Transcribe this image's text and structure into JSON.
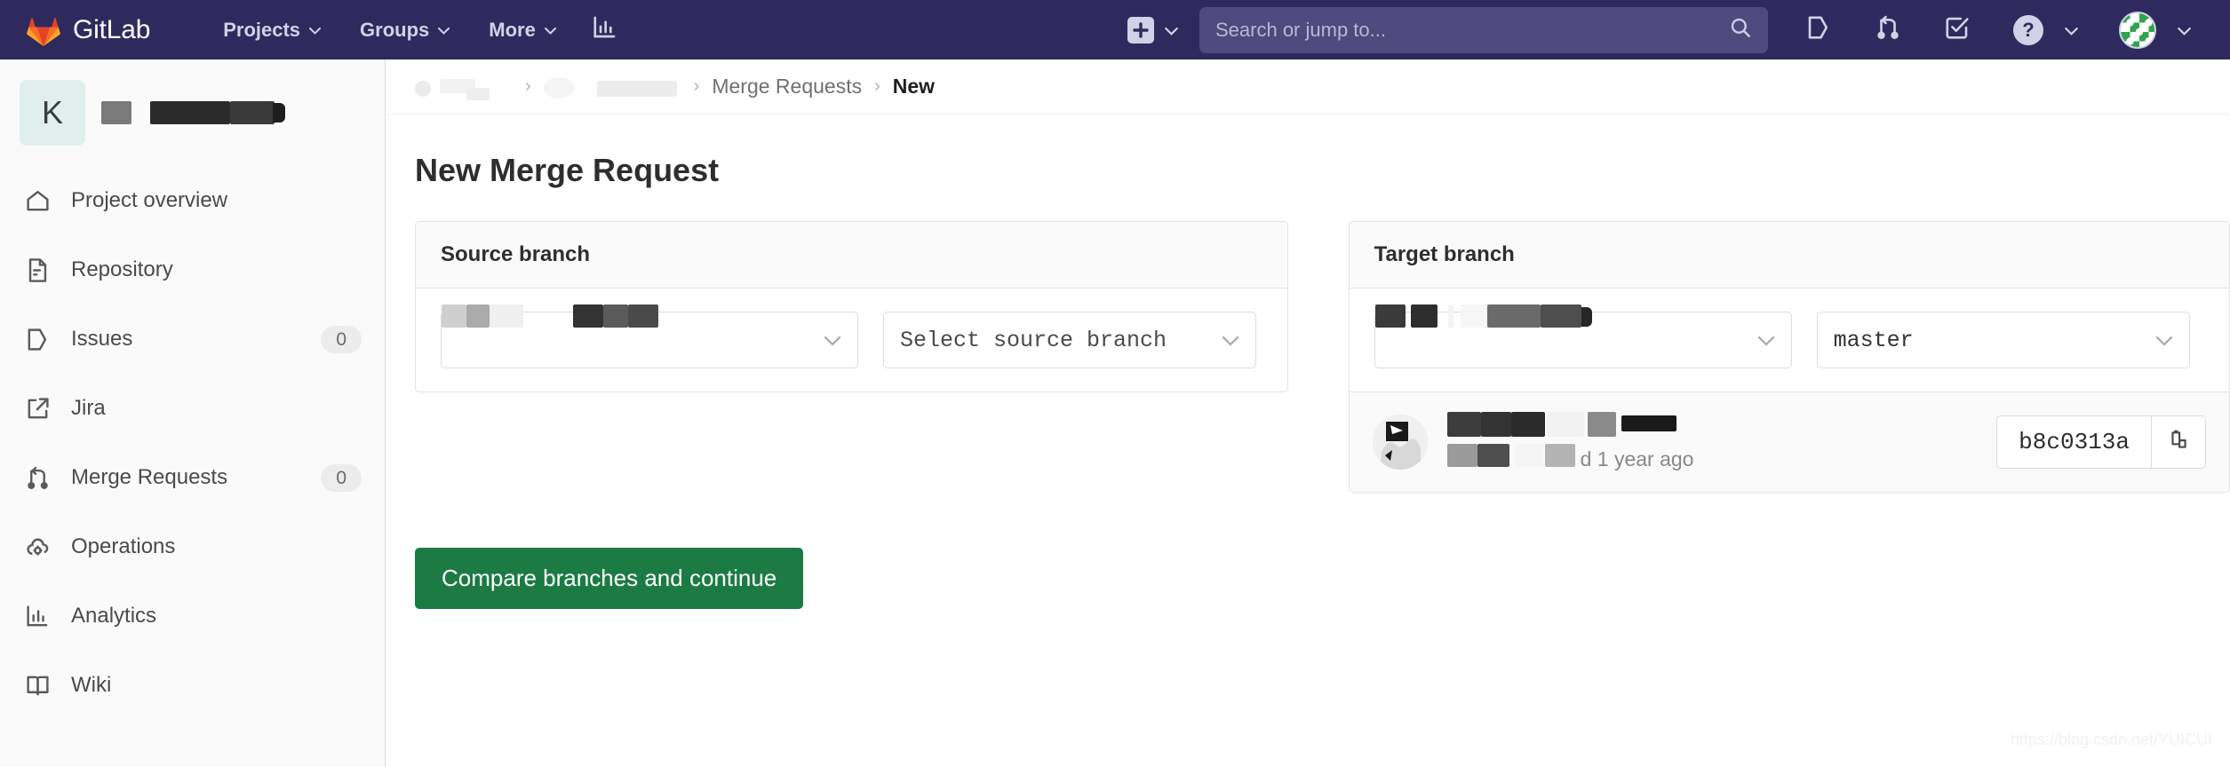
{
  "topnav": {
    "brand": "GitLab",
    "brand_icon": "gitlab-logo-icon",
    "links": [
      {
        "label": "Projects",
        "icon": "chevron-down-icon"
      },
      {
        "label": "Groups",
        "icon": "chevron-down-icon"
      },
      {
        "label": "More",
        "icon": "chevron-down-icon"
      }
    ],
    "analytics_icon": "bar-chart-icon",
    "new_icon": "plus-square-icon",
    "new_chevron_icon": "chevron-down-icon",
    "search": {
      "placeholder": "Search or jump to...",
      "value": "",
      "icon": "search-icon"
    },
    "right_icons": [
      {
        "name": "issues-icon"
      },
      {
        "name": "merge-request-icon"
      },
      {
        "name": "todos-check-icon"
      },
      {
        "name": "help-question-icon"
      }
    ],
    "help_glyph": "?",
    "avatar_icon": "user-avatar",
    "bg_color": "#2e2a5d",
    "search_bg_color": "#4e4a7e"
  },
  "sidebar": {
    "project": {
      "initial": "K",
      "name": "",
      "avatar_bg": "#e0efed"
    },
    "items": [
      {
        "label": "Project overview",
        "icon": "home-icon",
        "badge": ""
      },
      {
        "label": "Repository",
        "icon": "document-icon",
        "badge": ""
      },
      {
        "label": "Issues",
        "icon": "issues-icon",
        "badge": "0"
      },
      {
        "label": "Jira",
        "icon": "external-link-icon",
        "badge": ""
      },
      {
        "label": "Merge Requests",
        "icon": "merge-request-icon",
        "badge": "0"
      },
      {
        "label": "Operations",
        "icon": "cloud-gear-icon",
        "badge": ""
      },
      {
        "label": "Analytics",
        "icon": "bar-chart-icon",
        "badge": ""
      },
      {
        "label": "Wiki",
        "icon": "book-icon",
        "badge": ""
      }
    ]
  },
  "breadcrumb": {
    "items": [
      {
        "label": "",
        "redacted": true
      },
      {
        "label": "",
        "redacted": true
      },
      {
        "label": "Merge Requests",
        "redacted": false
      },
      {
        "label": "New",
        "redacted": false,
        "current": true
      }
    ],
    "separator": "›"
  },
  "page": {
    "title": "New Merge Request",
    "compare_button": "Compare branches and continue",
    "compare_button_color": "#1b7b43"
  },
  "source_panel": {
    "heading": "Source branch",
    "project_dropdown": {
      "value": "",
      "redacted": true,
      "chevron": "chevron-down-icon"
    },
    "branch_dropdown": {
      "value": "Select source branch",
      "chevron": "chevron-down-icon"
    }
  },
  "target_panel": {
    "heading": "Target branch",
    "project_dropdown": {
      "value": "",
      "redacted": true,
      "chevron": "chevron-down-icon"
    },
    "branch_dropdown": {
      "value": "master",
      "chevron": "chevron-down-icon"
    },
    "commit": {
      "author": "",
      "message": "",
      "authored_time": "d 1 year ago",
      "sha": "b8c0313a",
      "copy_icon": "clipboard-copy-icon",
      "avatar_icon": "commit-author-avatar"
    }
  },
  "watermark": "https://blog.csdn.net/YUICUI"
}
